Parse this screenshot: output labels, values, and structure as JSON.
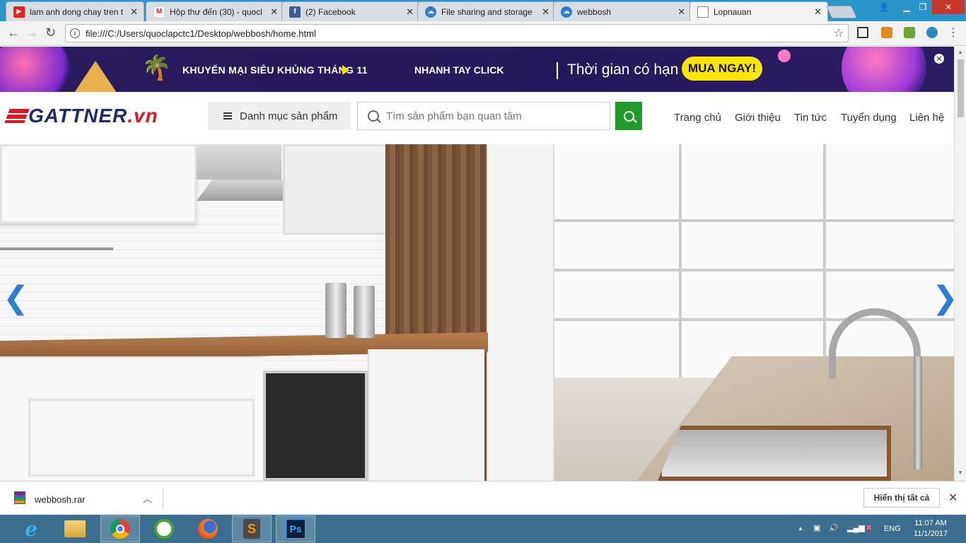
{
  "browser": {
    "tabs": [
      {
        "title": "lam anh dong chay tren t",
        "favicon": "youtube-icon",
        "color": "#e62117"
      },
      {
        "title": "Hộp thư đến (30) - quocl",
        "favicon": "gmail-icon",
        "color": "#d93025"
      },
      {
        "title": "(2) Facebook",
        "favicon": "facebook-icon",
        "color": "#3b5998"
      },
      {
        "title": "File sharing and storage",
        "favicon": "cloud-icon",
        "color": "#2a80d0"
      },
      {
        "title": "webbosh",
        "favicon": "cloud-icon",
        "color": "#2a80d0"
      },
      {
        "title": "Lopnauan",
        "favicon": "page-icon",
        "color": "#888888"
      }
    ],
    "active_tab": 5,
    "url": "file:///C:/Users/quoclapctc1/Desktop/webbosh/home.html"
  },
  "banner": {
    "promo": "KHUYẾN MẠI SIÊU KHỦNG THÁNG 11",
    "click": "NHANH TAY CLICK",
    "time": "Thời gian có hạn",
    "buy": "MUA NGAY!"
  },
  "header": {
    "logo_main": "GATTNER",
    "logo_tld": ".vn",
    "category": "Danh mục sản phẩm",
    "search_placeholder": "Tìm sản phẩm bạn quan tâm",
    "nav": [
      "Trang chủ",
      "Giới thiệu",
      "Tin tức",
      "Tuyển dụng",
      "Liên hệ"
    ]
  },
  "colors": {
    "accent": "#1e9b2a",
    "banner_bg": "#24195a",
    "logo": "#1f2a6b",
    "logo_red": "#d71921",
    "arrows": "#2c7fcf"
  },
  "download": {
    "filename": "webbosh.rar",
    "show_all": "Hiển thị tất cả"
  },
  "taskbar": {
    "apps": [
      "ie-icon",
      "explorer-icon",
      "chrome-icon",
      "coccoc-icon",
      "firefox-icon",
      "sublime-icon",
      "photoshop-icon"
    ],
    "lang": "ENG",
    "time": "11:07 AM",
    "date": "11/1/2017"
  }
}
